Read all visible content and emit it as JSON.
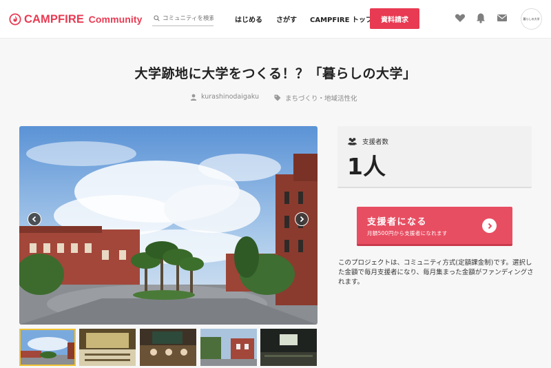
{
  "header": {
    "logo_text": "CAMPFIRE",
    "logo_sub": "Community",
    "search_placeholder": "コミュニティを検索",
    "nav": {
      "start": "はじめる",
      "find": "さがす",
      "top": "CAMPFIRE トップ"
    },
    "request_button": "資料請求",
    "avatar_text": "暮らしの大学"
  },
  "project": {
    "title": "大学跡地に大学をつくる！？「暮らしの大学」",
    "owner": "kurashinodaigaku",
    "category": "まちづくり・地域活性化"
  },
  "supporters": {
    "label": "支援者数",
    "value": "1人"
  },
  "cta": {
    "main": "支援者になる",
    "sub": "月額500円から支援者になれます"
  },
  "description": "このプロジェクトは、コミュニティ方式(定額課金制)です。選択した金額で毎月支援者になり、毎月集まった金額がファンディングされます。",
  "colors": {
    "brand": "#e83a52",
    "cta": "#e84e62",
    "thumb_active": "#f1c232"
  }
}
